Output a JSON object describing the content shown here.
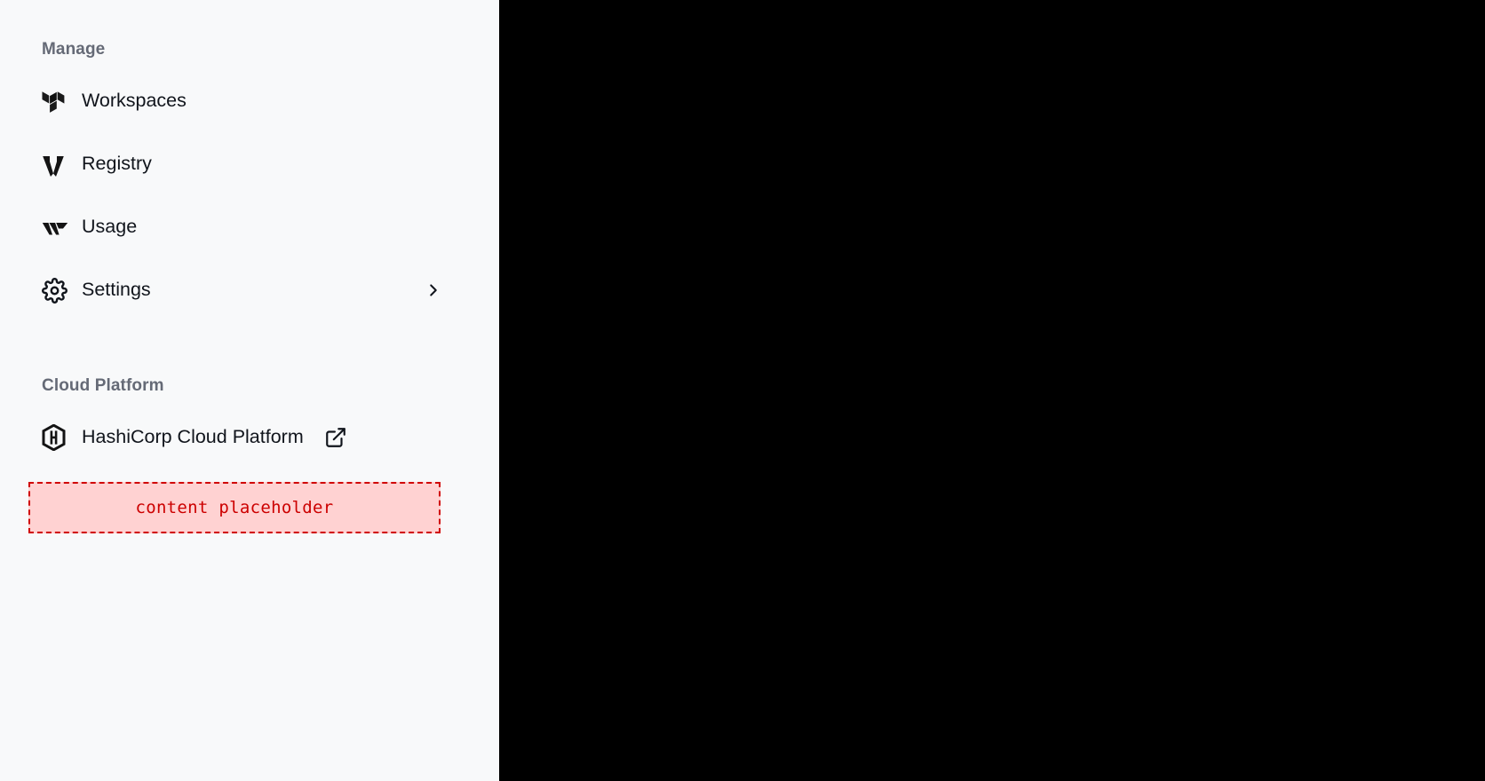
{
  "sidebar": {
    "sections": [
      {
        "id": "manage",
        "header": "Manage",
        "items": [
          {
            "label": "Workspaces",
            "icon": "terraform-logo-icon",
            "trailing": "none"
          },
          {
            "label": "Registry",
            "icon": "vault-logo-icon",
            "trailing": "none"
          },
          {
            "label": "Usage",
            "icon": "waypoint-logo-icon",
            "trailing": "none"
          },
          {
            "label": "Settings",
            "icon": "gear-icon",
            "trailing": "chevron-right-icon"
          }
        ]
      },
      {
        "id": "cloud-platform",
        "header": "Cloud Platform",
        "items": [
          {
            "label": "HashiCorp Cloud Platform",
            "icon": "hashicorp-logo-icon",
            "trailing": "external-link-icon"
          }
        ]
      }
    ],
    "placeholder": {
      "label": "content placeholder"
    }
  },
  "colors": {
    "sidebar_background": "#f8f9fa",
    "main_background": "#000000",
    "section_header_text": "#656a76",
    "item_label_text": "#11151c",
    "placeholder_border": "#d00000",
    "placeholder_fill": "#ffd2d2",
    "placeholder_text": "#cc0000"
  }
}
